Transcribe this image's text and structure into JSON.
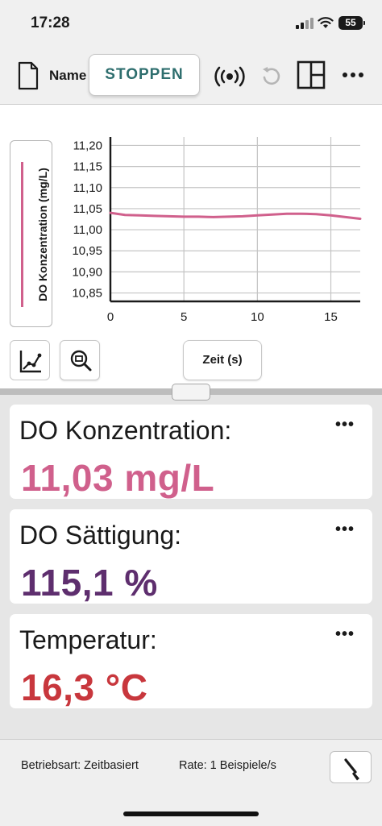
{
  "status": {
    "time": "17:28",
    "battery": "55"
  },
  "toolbar": {
    "name_label": "Name",
    "stop_label": "STOPPEN",
    "icons": [
      "file-icon",
      "sensor-signal-icon",
      "undo-icon",
      "layout-icon",
      "more-icon"
    ]
  },
  "graph": {
    "y_axis_label": "DO Konzentration (mg/L)",
    "x_axis_label": "Zeit (s)",
    "series_color": "#d0608c"
  },
  "chart_data": {
    "type": "line",
    "xlabel": "Zeit (s)",
    "ylabel": "DO Konzentration (mg/L)",
    "xlim": [
      0,
      17
    ],
    "ylim": [
      10.83,
      11.22
    ],
    "x_ticks": [
      0,
      5,
      10,
      15
    ],
    "x_tick_labels": [
      "0",
      "5",
      "10",
      "15"
    ],
    "y_ticks": [
      11.2,
      11.15,
      11.1,
      11.05,
      11.0,
      10.95,
      10.9,
      10.85
    ],
    "y_tick_labels": [
      "11,20",
      "11,15",
      "11,10",
      "11,05",
      "11,00",
      "10,95",
      "10,90",
      "10,85"
    ],
    "grid": true,
    "series": [
      {
        "color": "#d0608c",
        "x": [
          0,
          1,
          2,
          3,
          4,
          5,
          6,
          7,
          8,
          9,
          10,
          11,
          12,
          13,
          14,
          15,
          16,
          17
        ],
        "y": [
          11.04,
          11.035,
          11.034,
          11.033,
          11.032,
          11.031,
          11.031,
          11.03,
          11.031,
          11.032,
          11.034,
          11.036,
          11.038,
          11.038,
          11.037,
          11.034,
          11.03,
          11.026
        ]
      }
    ]
  },
  "meters": [
    {
      "label": "DO Konzentration:",
      "value": "11,03 mg/L",
      "color": "#d0608c",
      "menu": "•••"
    },
    {
      "label": "DO Sättigung:",
      "value": "115,1 %",
      "color": "#5e2e6e",
      "menu": "•••"
    },
    {
      "label": "Temperatur:",
      "value": "16,3 °C",
      "color": "#c8373d",
      "menu": "•••"
    }
  ],
  "footer": {
    "mode": "Betriebsart: Zeitbasiert",
    "rate": "Rate: 1 Beispiele/s"
  }
}
